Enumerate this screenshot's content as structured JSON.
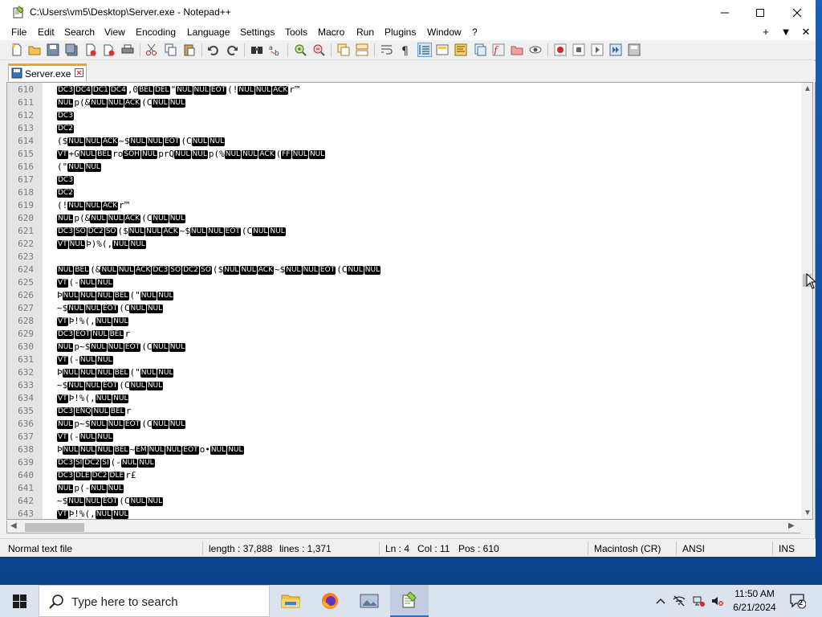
{
  "window": {
    "title": "C:\\Users\\vm5\\Desktop\\Server.exe - Notepad++"
  },
  "menu": {
    "items": [
      "File",
      "Edit",
      "Search",
      "View",
      "Encoding",
      "Language",
      "Settings",
      "Tools",
      "Macro",
      "Run",
      "Plugins",
      "Window",
      "?"
    ],
    "right": [
      "+",
      "▼",
      "✕"
    ]
  },
  "tab": {
    "label": "Server.exe"
  },
  "editor": {
    "lines": [
      {
        "n": "610",
        "segs": [
          [
            "c",
            "DC3"
          ],
          [
            "c",
            "DC4"
          ],
          [
            "c",
            "DC1"
          ],
          [
            "c",
            "DC4"
          ],
          [
            "t",
            ",0"
          ],
          [
            "c",
            "BEL"
          ],
          [
            "c",
            "DEL"
          ],
          [
            "t",
            "\""
          ],
          [
            "c",
            "NUL"
          ],
          [
            "c",
            "NUL"
          ],
          [
            "c",
            "EOT"
          ],
          [
            "t",
            "(!"
          ],
          [
            "c",
            "NUL"
          ],
          [
            "c",
            "NUL"
          ],
          [
            "c",
            "ACK"
          ],
          [
            "t",
            "r™"
          ]
        ]
      },
      {
        "n": "611",
        "segs": [
          [
            "c",
            "NUL"
          ],
          [
            "t",
            "p(&"
          ],
          [
            "c",
            "NUL"
          ],
          [
            "c",
            "NUL"
          ],
          [
            "c",
            "ACK"
          ],
          [
            "t",
            "(C"
          ],
          [
            "c",
            "NUL"
          ],
          [
            "c",
            "NUL"
          ]
        ]
      },
      {
        "n": "612",
        "segs": [
          [
            "c",
            "DC3"
          ]
        ]
      },
      {
        "n": "613",
        "segs": [
          [
            "c",
            "DC2"
          ]
        ]
      },
      {
        "n": "614",
        "segs": [
          [
            "t",
            "($"
          ],
          [
            "c",
            "NUL"
          ],
          [
            "c",
            "NUL"
          ],
          [
            "c",
            "ACK"
          ],
          [
            "t",
            "~$"
          ],
          [
            "c",
            "NUL"
          ],
          [
            "c",
            "NUL"
          ],
          [
            "c",
            "EOT"
          ],
          [
            "t",
            "(C"
          ],
          [
            "c",
            "NUL"
          ],
          [
            "c",
            "NUL"
          ]
        ]
      },
      {
        "n": "615",
        "segs": [
          [
            "c",
            "VT"
          ],
          [
            "t",
            "+G"
          ],
          [
            "c",
            "NUL"
          ],
          [
            "c",
            "BEL"
          ],
          [
            "t",
            "ro"
          ],
          [
            "c",
            "SOH"
          ],
          [
            "c",
            "NUL"
          ],
          [
            "t",
            "prQ"
          ],
          [
            "c",
            "NUL"
          ],
          [
            "c",
            "NUL"
          ],
          [
            "t",
            "p(%"
          ],
          [
            "c",
            "NUL"
          ],
          [
            "c",
            "NUL"
          ],
          [
            "c",
            "ACK"
          ],
          [
            "t",
            "("
          ],
          [
            "c",
            "FF"
          ],
          [
            "c",
            "NUL"
          ],
          [
            "c",
            "NUL"
          ]
        ]
      },
      {
        "n": "616",
        "segs": [
          [
            "t",
            "(\""
          ],
          [
            "c",
            "NUL"
          ],
          [
            "c",
            "NUL"
          ]
        ]
      },
      {
        "n": "617",
        "segs": [
          [
            "c",
            "DC3"
          ]
        ]
      },
      {
        "n": "618",
        "segs": [
          [
            "c",
            "DC2"
          ]
        ]
      },
      {
        "n": "619",
        "segs": [
          [
            "t",
            "(!"
          ],
          [
            "c",
            "NUL"
          ],
          [
            "c",
            "NUL"
          ],
          [
            "c",
            "ACK"
          ],
          [
            "t",
            "r™"
          ]
        ]
      },
      {
        "n": "620",
        "segs": [
          [
            "c",
            "NUL"
          ],
          [
            "t",
            "p(&"
          ],
          [
            "c",
            "NUL"
          ],
          [
            "c",
            "NUL"
          ],
          [
            "c",
            "ACK"
          ],
          [
            "t",
            "(C"
          ],
          [
            "c",
            "NUL"
          ],
          [
            "c",
            "NUL"
          ]
        ]
      },
      {
        "n": "621",
        "segs": [
          [
            "c",
            "DC3"
          ],
          [
            "c",
            "SO"
          ],
          [
            "c",
            "DC2"
          ],
          [
            "c",
            "SO"
          ],
          [
            "t",
            "($"
          ],
          [
            "c",
            "NUL"
          ],
          [
            "c",
            "NUL"
          ],
          [
            "c",
            "ACK"
          ],
          [
            "t",
            "~$"
          ],
          [
            "c",
            "NUL"
          ],
          [
            "c",
            "NUL"
          ],
          [
            "c",
            "EOT"
          ],
          [
            "t",
            "(C"
          ],
          [
            "c",
            "NUL"
          ],
          [
            "c",
            "NUL"
          ]
        ]
      },
      {
        "n": "622",
        "segs": [
          [
            "c",
            "VT"
          ],
          [
            "c",
            "NUL"
          ],
          [
            "t",
            "Þ)%(,"
          ],
          [
            "c",
            "NUL"
          ],
          [
            "c",
            "NUL"
          ]
        ]
      },
      {
        "n": "623",
        "segs": []
      },
      {
        "n": "624",
        "segs": [
          [
            "c",
            "NUL"
          ],
          [
            "c",
            "BEL"
          ],
          [
            "t",
            "(&"
          ],
          [
            "c",
            "NUL"
          ],
          [
            "c",
            "NUL"
          ],
          [
            "c",
            "ACK"
          ],
          [
            "c",
            "DC3"
          ],
          [
            "c",
            "SO"
          ],
          [
            "c",
            "DC2"
          ],
          [
            "c",
            "SO"
          ],
          [
            "t",
            "($"
          ],
          [
            "c",
            "NUL"
          ],
          [
            "c",
            "NUL"
          ],
          [
            "c",
            "ACK"
          ],
          [
            "t",
            "~$"
          ],
          [
            "c",
            "NUL"
          ],
          [
            "c",
            "NUL"
          ],
          [
            "c",
            "EOT"
          ],
          [
            "t",
            "(C"
          ],
          [
            "c",
            "NUL"
          ],
          [
            "c",
            "NUL"
          ]
        ]
      },
      {
        "n": "625",
        "segs": [
          [
            "c",
            "VT"
          ],
          [
            "t",
            "(-"
          ],
          [
            "c",
            "NUL"
          ],
          [
            "c",
            "NUL"
          ]
        ]
      },
      {
        "n": "626",
        "segs": [
          [
            "t",
            "Þ"
          ],
          [
            "c",
            "NUL"
          ],
          [
            "c",
            "NUL"
          ],
          [
            "c",
            "NUL"
          ],
          [
            "c",
            "BEL"
          ],
          [
            "t",
            "(\""
          ],
          [
            "c",
            "NUL"
          ],
          [
            "c",
            "NUL"
          ]
        ]
      },
      {
        "n": "627",
        "segs": [
          [
            "t",
            "~$"
          ],
          [
            "c",
            "NUL"
          ],
          [
            "c",
            "NUL"
          ],
          [
            "c",
            "EOT"
          ],
          [
            "t",
            "(C"
          ],
          [
            "c",
            "NUL"
          ],
          [
            "c",
            "NUL"
          ]
        ]
      },
      {
        "n": "628",
        "segs": [
          [
            "c",
            "VT"
          ],
          [
            "t",
            "Þ!%(,"
          ],
          [
            "c",
            "NUL"
          ],
          [
            "c",
            "NUL"
          ]
        ]
      },
      {
        "n": "629",
        "segs": [
          [
            "c",
            "DC3"
          ],
          [
            "c",
            "EOT"
          ],
          [
            "c",
            "NUL"
          ],
          [
            "c",
            "BEL"
          ],
          [
            "t",
            "r"
          ]
        ]
      },
      {
        "n": "630",
        "segs": [
          [
            "c",
            "NUL"
          ],
          [
            "t",
            "p~$"
          ],
          [
            "c",
            "NUL"
          ],
          [
            "c",
            "NUL"
          ],
          [
            "c",
            "EOT"
          ],
          [
            "t",
            "(C"
          ],
          [
            "c",
            "NUL"
          ],
          [
            "c",
            "NUL"
          ]
        ]
      },
      {
        "n": "631",
        "segs": [
          [
            "c",
            "VT"
          ],
          [
            "t",
            "(-"
          ],
          [
            "c",
            "NUL"
          ],
          [
            "c",
            "NUL"
          ]
        ]
      },
      {
        "n": "632",
        "segs": [
          [
            "t",
            "Þ"
          ],
          [
            "c",
            "NUL"
          ],
          [
            "c",
            "NUL"
          ],
          [
            "c",
            "NUL"
          ],
          [
            "c",
            "BEL"
          ],
          [
            "t",
            "(\""
          ],
          [
            "c",
            "NUL"
          ],
          [
            "c",
            "NUL"
          ]
        ]
      },
      {
        "n": "633",
        "segs": [
          [
            "t",
            "~$"
          ],
          [
            "c",
            "NUL"
          ],
          [
            "c",
            "NUL"
          ],
          [
            "c",
            "EOT"
          ],
          [
            "t",
            "(C"
          ],
          [
            "c",
            "NUL"
          ],
          [
            "c",
            "NUL"
          ]
        ]
      },
      {
        "n": "634",
        "segs": [
          [
            "c",
            "VT"
          ],
          [
            "t",
            "Þ!%(,"
          ],
          [
            "c",
            "NUL"
          ],
          [
            "c",
            "NUL"
          ]
        ]
      },
      {
        "n": "635",
        "segs": [
          [
            "c",
            "DC3"
          ],
          [
            "c",
            "ENQ"
          ],
          [
            "c",
            "NUL"
          ],
          [
            "c",
            "BEL"
          ],
          [
            "t",
            "r"
          ]
        ]
      },
      {
        "n": "636",
        "segs": [
          [
            "c",
            "NUL"
          ],
          [
            "t",
            "p~$"
          ],
          [
            "c",
            "NUL"
          ],
          [
            "c",
            "NUL"
          ],
          [
            "c",
            "EOT"
          ],
          [
            "t",
            "(C"
          ],
          [
            "c",
            "NUL"
          ],
          [
            "c",
            "NUL"
          ]
        ]
      },
      {
        "n": "637",
        "segs": [
          [
            "c",
            "VT"
          ],
          [
            "t",
            "(-"
          ],
          [
            "c",
            "NUL"
          ],
          [
            "c",
            "NUL"
          ]
        ]
      },
      {
        "n": "638",
        "segs": [
          [
            "t",
            "Þ"
          ],
          [
            "c",
            "NUL"
          ],
          [
            "c",
            "NUL"
          ],
          [
            "c",
            "NUL"
          ],
          [
            "c",
            "BEL"
          ],
          [
            "t",
            "~"
          ],
          [
            "c",
            "EM"
          ],
          [
            "c",
            "NUL"
          ],
          [
            "c",
            "NUL"
          ],
          [
            "c",
            "EOT"
          ],
          [
            "t",
            "o•"
          ],
          [
            "c",
            "NUL"
          ],
          [
            "c",
            "NUL"
          ]
        ]
      },
      {
        "n": "639",
        "segs": [
          [
            "c",
            "DC3"
          ],
          [
            "c",
            "SI"
          ],
          [
            "c",
            "DC2"
          ],
          [
            "c",
            "SI"
          ],
          [
            "t",
            "(-"
          ],
          [
            "c",
            "NUL"
          ],
          [
            "c",
            "NUL"
          ]
        ]
      },
      {
        "n": "640",
        "segs": [
          [
            "c",
            "DC3"
          ],
          [
            "c",
            "DLE"
          ],
          [
            "c",
            "DC2"
          ],
          [
            "c",
            "DLE"
          ],
          [
            "t",
            "r£"
          ]
        ]
      },
      {
        "n": "641",
        "segs": [
          [
            "c",
            "NUL"
          ],
          [
            "t",
            "p(-"
          ],
          [
            "c",
            "NUL"
          ],
          [
            "c",
            "NUL"
          ]
        ]
      },
      {
        "n": "642",
        "segs": [
          [
            "t",
            "~$"
          ],
          [
            "c",
            "NUL"
          ],
          [
            "c",
            "NUL"
          ],
          [
            "c",
            "EOT"
          ],
          [
            "t",
            "(C"
          ],
          [
            "c",
            "NUL"
          ],
          [
            "c",
            "NUL"
          ]
        ]
      },
      {
        "n": "643",
        "segs": [
          [
            "c",
            "VT"
          ],
          [
            "t",
            "Þ!%(,"
          ],
          [
            "c",
            "NUL"
          ],
          [
            "c",
            "NUL"
          ]
        ]
      }
    ]
  },
  "status": {
    "file_type": "Normal text file",
    "length": "length : 37,888",
    "lines": "lines : 1,371",
    "ln": "Ln : 4",
    "col": "Col : 11",
    "pos": "Pos : 610",
    "eol": "Macintosh (CR)",
    "encoding": "ANSI",
    "mode": "INS"
  },
  "taskbar": {
    "search_placeholder": "Type here to search",
    "time": "11:50 AM",
    "date": "6/21/2024",
    "notification_count": "2"
  },
  "colors": {
    "accent": "#f0a030",
    "desktop": "#1a5fb4"
  }
}
